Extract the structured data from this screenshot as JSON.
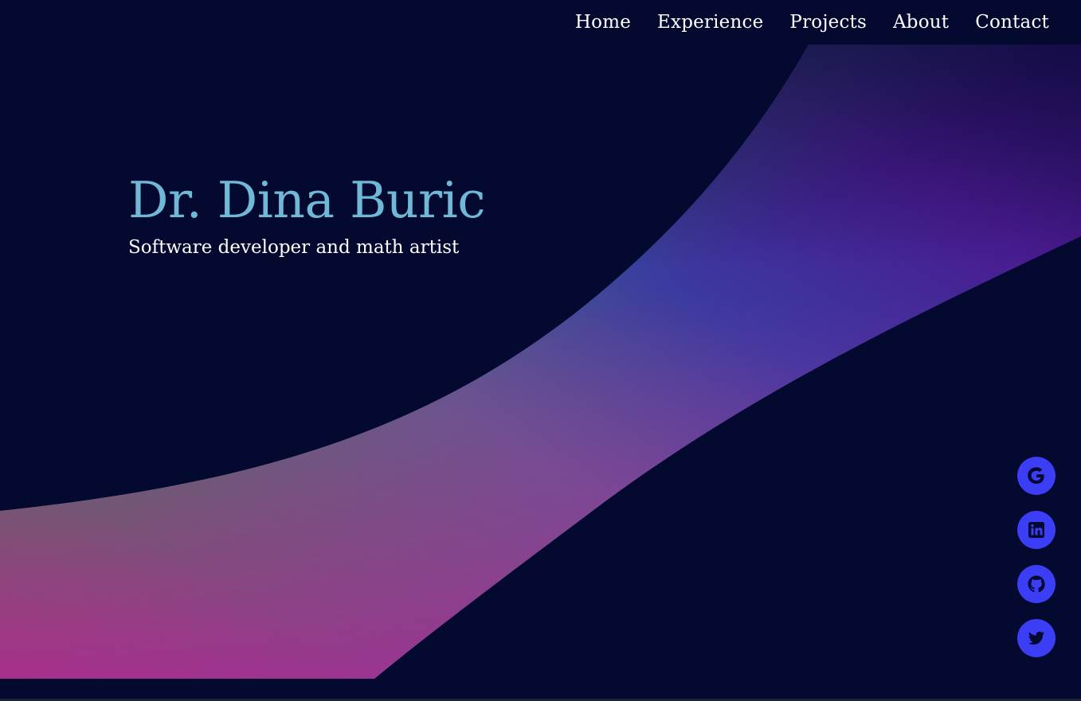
{
  "nav": {
    "items": [
      {
        "label": "Home"
      },
      {
        "label": "Experience"
      },
      {
        "label": "Projects"
      },
      {
        "label": "About"
      },
      {
        "label": "Contact"
      }
    ]
  },
  "hero": {
    "title": "Dr. Dina Buric",
    "subtitle": "Software developer and math artist"
  },
  "social": {
    "items": [
      {
        "icon": "google-icon"
      },
      {
        "icon": "linkedin-icon"
      },
      {
        "icon": "github-icon"
      },
      {
        "icon": "twitter-icon"
      }
    ]
  },
  "colors": {
    "background": "#03092f",
    "title": "#6fb8d6",
    "accent": "#3b3ef5"
  }
}
